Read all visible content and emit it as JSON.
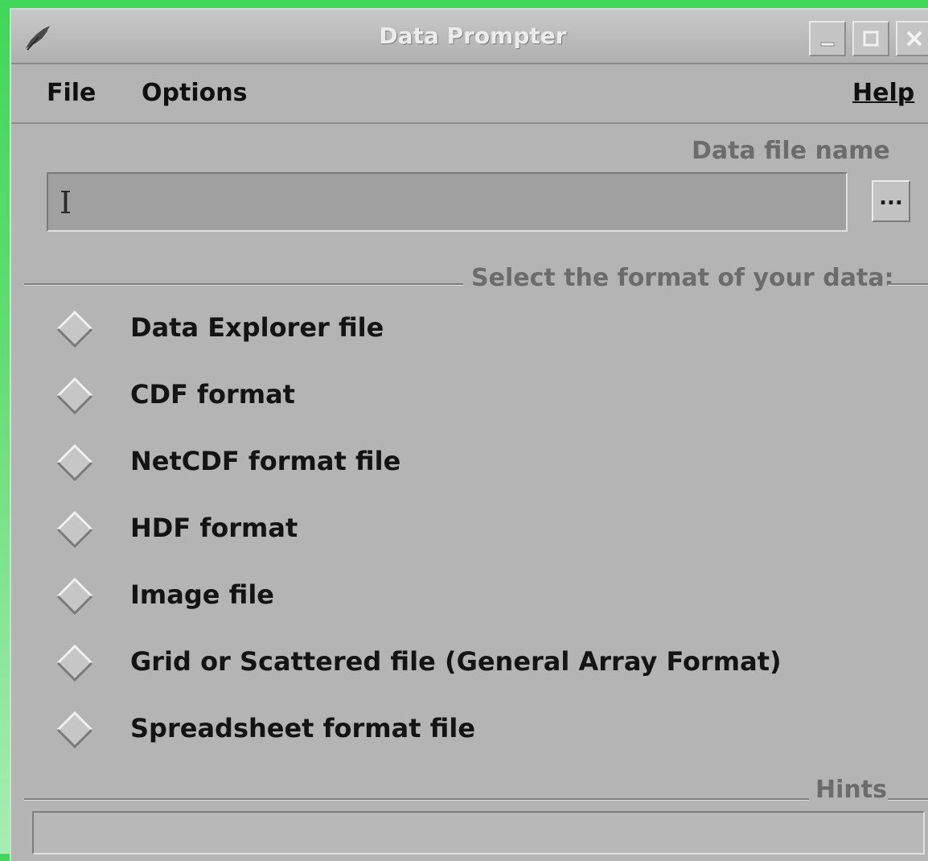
{
  "window": {
    "title": "Data Prompter",
    "controls": [
      "minimize",
      "maximize",
      "close"
    ]
  },
  "menubar": {
    "file": "File",
    "options": "Options",
    "help": "Help"
  },
  "file_section": {
    "label": "Data file name",
    "value": "",
    "browse_label": "..."
  },
  "format_section": {
    "title": "Select the format of your data:",
    "options": [
      {
        "label": "Data Explorer file",
        "selected": false
      },
      {
        "label": "CDF format",
        "selected": false
      },
      {
        "label": "NetCDF format file",
        "selected": false
      },
      {
        "label": "HDF format",
        "selected": false
      },
      {
        "label": "Image file",
        "selected": false
      },
      {
        "label": "Grid or Scattered file (General Array Format)",
        "selected": false
      },
      {
        "label": "Spreadsheet format file",
        "selected": false
      }
    ]
  },
  "hints": {
    "title": "Hints",
    "text": ""
  },
  "icons": {
    "app": "feather-icon",
    "radio": "diamond-radio-icon"
  }
}
